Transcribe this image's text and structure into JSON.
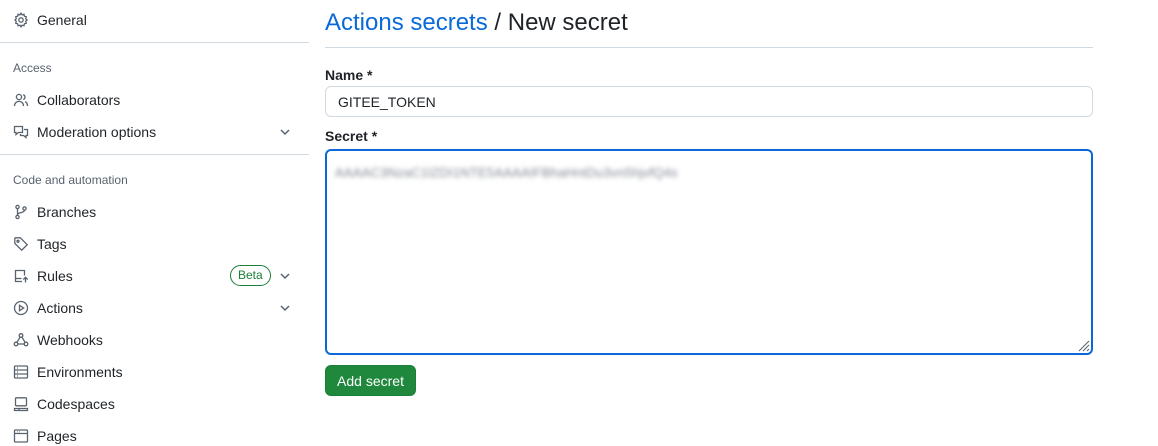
{
  "sidebar": {
    "general": {
      "label": "General",
      "icon": "gear-icon"
    },
    "access_header": "Access",
    "access_items": [
      {
        "label": "Collaborators",
        "icon": "people-icon"
      },
      {
        "label": "Moderation options",
        "icon": "comment-discussion-icon",
        "expandable": true
      }
    ],
    "code_header": "Code and automation",
    "code_items": [
      {
        "label": "Branches",
        "icon": "git-branch-icon"
      },
      {
        "label": "Tags",
        "icon": "tag-icon"
      },
      {
        "label": "Rules",
        "icon": "repo-push-icon",
        "badge": "Beta",
        "expandable": true
      },
      {
        "label": "Actions",
        "icon": "play-icon",
        "expandable": true
      },
      {
        "label": "Webhooks",
        "icon": "webhook-icon"
      },
      {
        "label": "Environments",
        "icon": "server-icon"
      },
      {
        "label": "Codespaces",
        "icon": "codespaces-icon"
      },
      {
        "label": "Pages",
        "icon": "browser-icon"
      }
    ]
  },
  "main": {
    "breadcrumb_link": "Actions secrets",
    "breadcrumb_separator": "/",
    "page_title": "New secret",
    "name_label": "Name *",
    "name_value": "GITEE_TOKEN",
    "secret_label": "Secret *",
    "secret_value": "AAAAC3NzaC1lZDI1NTE5AAAAIFBhaHntDu3vn5hjvfQ4s",
    "submit_label": "Add secret"
  },
  "colors": {
    "link": "#0969da",
    "primary_button": "#1f883d",
    "badge": "#1a7f37",
    "focus_border": "#0969da",
    "muted_text": "#59636e",
    "border": "#d1d9e0"
  }
}
